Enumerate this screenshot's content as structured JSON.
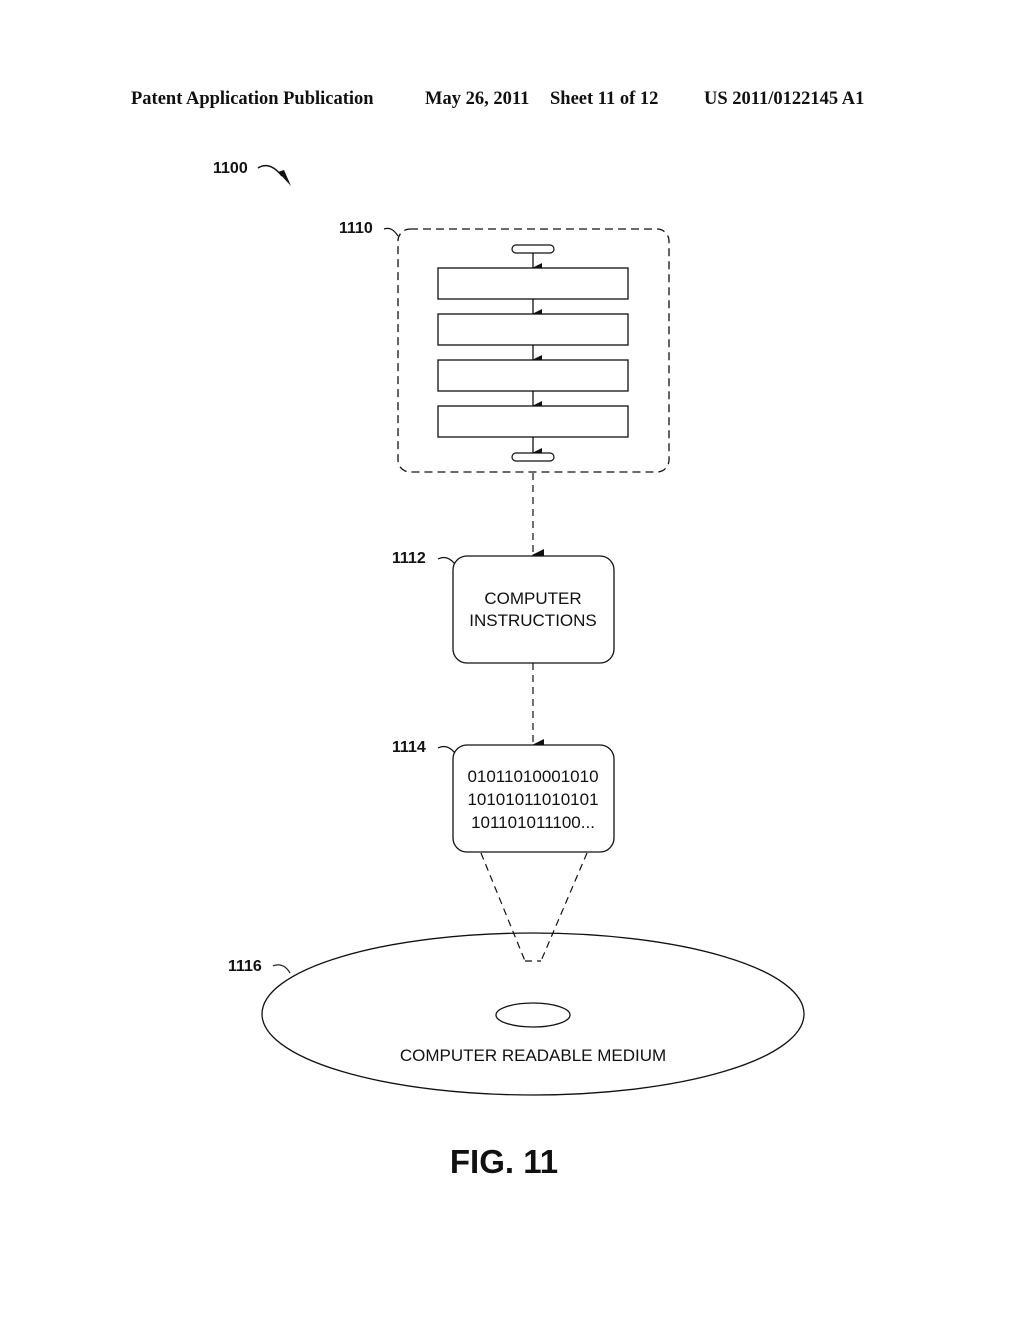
{
  "header": {
    "publication": "Patent Application Publication",
    "date": "May 26, 2011",
    "sheet": "Sheet 11 of 12",
    "number": "US 2011/0122145 A1"
  },
  "figure": {
    "ref_main": "1100",
    "flowchart": {
      "ref": "1110",
      "step_count": 4
    },
    "instructions": {
      "ref": "1112",
      "line1": "COMPUTER",
      "line2": "INSTRUCTIONS"
    },
    "binary": {
      "ref": "1114",
      "line1": "01011010001010",
      "line2": "10101011010101",
      "line3": "101101011100..."
    },
    "medium": {
      "ref": "1116",
      "label": "COMPUTER READABLE MEDIUM"
    },
    "caption": "FIG. 11"
  }
}
